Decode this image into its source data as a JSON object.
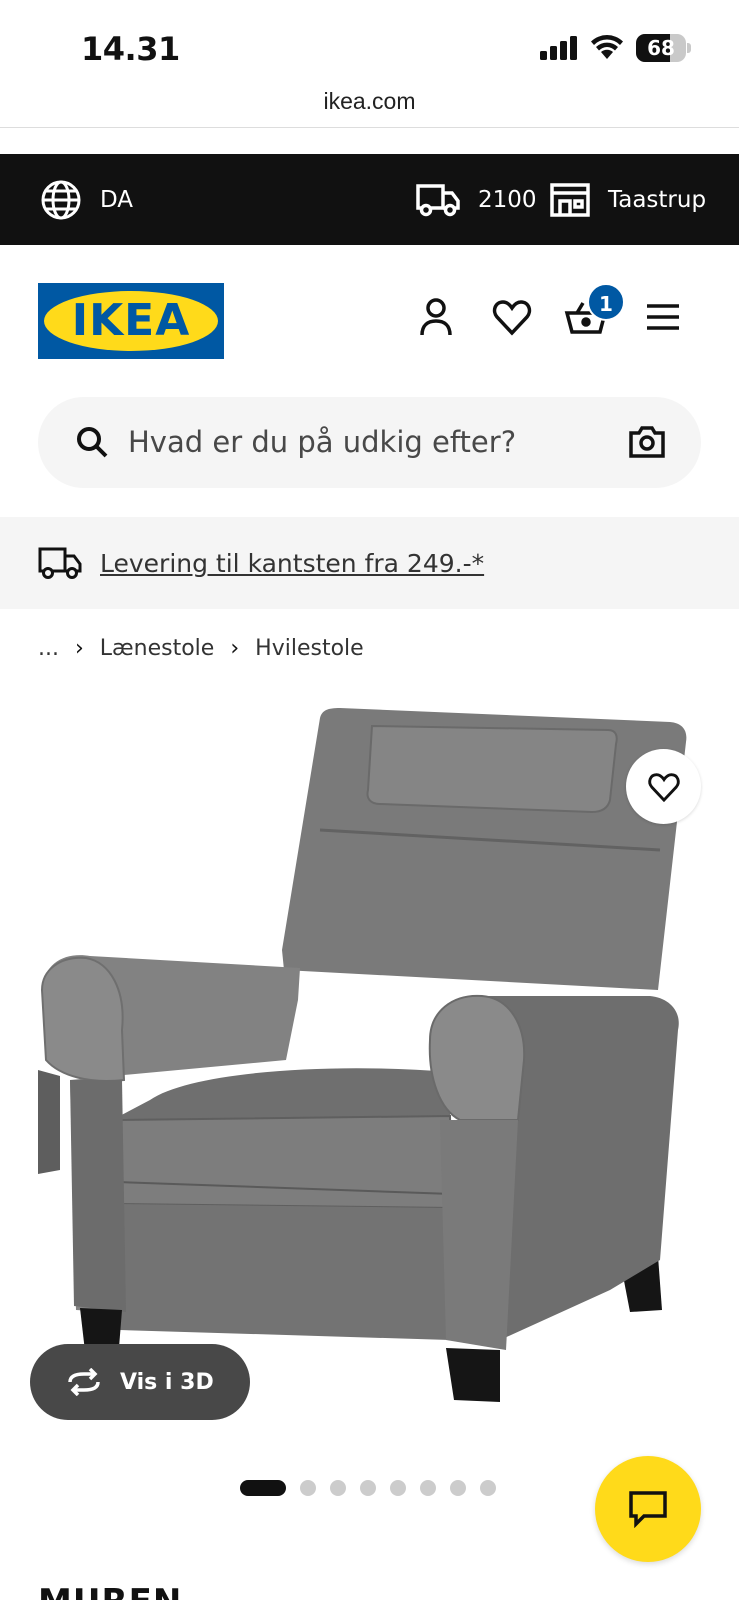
{
  "status_bar": {
    "time": "14.31",
    "battery": "68",
    "battery_level": 0.68
  },
  "browser": {
    "url": "ikea.com"
  },
  "topbar": {
    "language": "DA",
    "postal_code": "2100",
    "store": "Taastrup"
  },
  "header": {
    "logo_text": "IKEA",
    "cart_count": "1"
  },
  "search": {
    "placeholder": "Hvad er du på udkig efter?"
  },
  "promo": {
    "text": "Levering til kantsten fra 249.-*"
  },
  "breadcrumb": {
    "ellipsis": "...",
    "items": [
      "Lænestole",
      "Hvilestole"
    ]
  },
  "product": {
    "view_3d_label": "Vis i 3D",
    "image_count": 8,
    "active_image": 1,
    "name": "MUREN"
  },
  "colors": {
    "ikea_blue": "#0058a3",
    "ikea_yellow": "#ffda1a",
    "topbar_bg": "#111111"
  }
}
